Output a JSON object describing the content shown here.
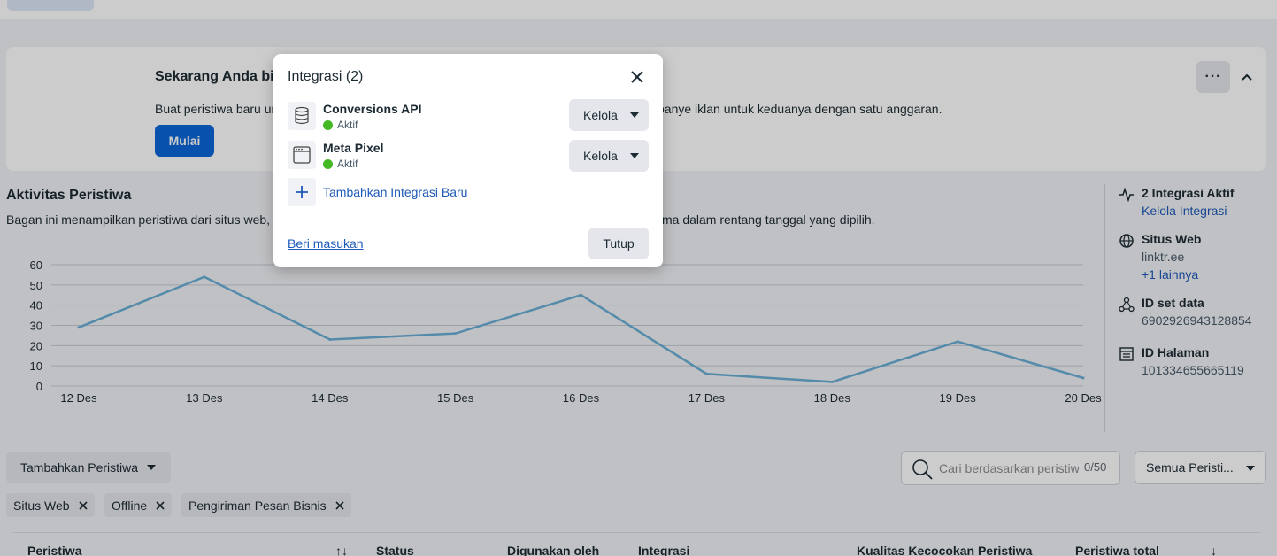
{
  "banner": {
    "title": "Sekarang Anda bis",
    "description_left": "Buat peristiwa baru ur",
    "description_right": "panye iklan untuk keduanya dengan satu anggaran.",
    "start_label": "Mulai",
    "more_label": "···"
  },
  "activity": {
    "title": "Aktivitas Peristiwa",
    "description_left": "Bagan ini menampilkan peristiwa dari situs web,",
    "description_right": "ma dalam rentang tanggal yang dipilih."
  },
  "chart_data": {
    "type": "line",
    "categories": [
      "12 Des",
      "13 Des",
      "14 Des",
      "15 Des",
      "16 Des",
      "17 Des",
      "18 Des",
      "19 Des",
      "20 Des"
    ],
    "values": [
      29,
      54,
      23,
      26,
      45,
      6,
      2,
      22,
      4
    ],
    "ylim": [
      0,
      60
    ],
    "yticks": [
      0,
      10,
      20,
      30,
      40,
      50,
      60
    ],
    "grid": true,
    "color": "#6aaed6"
  },
  "sidebar": {
    "integrations": {
      "title": "2 Integrasi Aktif",
      "link": "Kelola Integrasi",
      "icon": "activity-icon"
    },
    "website": {
      "title": "Situs Web",
      "value": "linktr.ee",
      "link": "+1 lainnya",
      "icon": "globe-icon"
    },
    "dataset": {
      "title": "ID set data",
      "value": "6902926943128854",
      "icon": "dataset-icon"
    },
    "page": {
      "title": "ID Halaman",
      "value": "101334655665119",
      "icon": "page-icon"
    }
  },
  "toolbar": {
    "add_event_label": "Tambahkan Peristiwa",
    "search_placeholder": "Cari berdasarkan peristiwa",
    "search_count": "0/50",
    "filter_label": "Semua Peristi..."
  },
  "chips": [
    "Situs Web",
    "Offline",
    "Pengiriman Pesan Bisnis"
  ],
  "table": {
    "columns": [
      "Peristiwa",
      "Status",
      "Digunakan oleh",
      "Integrasi",
      "Kualitas Kecocokan Peristiwa",
      "Peristiwa total"
    ],
    "sort_icon": "↑↓",
    "sort_down_icon": "↓"
  },
  "modal": {
    "title": "Integrasi (2)",
    "integrations": [
      {
        "name": "Conversions API",
        "status": "Aktif",
        "manage_label": "Kelola",
        "icon": "database-icon"
      },
      {
        "name": "Meta Pixel",
        "status": "Aktif",
        "manage_label": "Kelola",
        "icon": "browser-window-icon"
      }
    ],
    "add_label": "Tambahkan Integrasi Baru",
    "feedback_label": "Beri masukan",
    "close_label": "Tutup"
  }
}
